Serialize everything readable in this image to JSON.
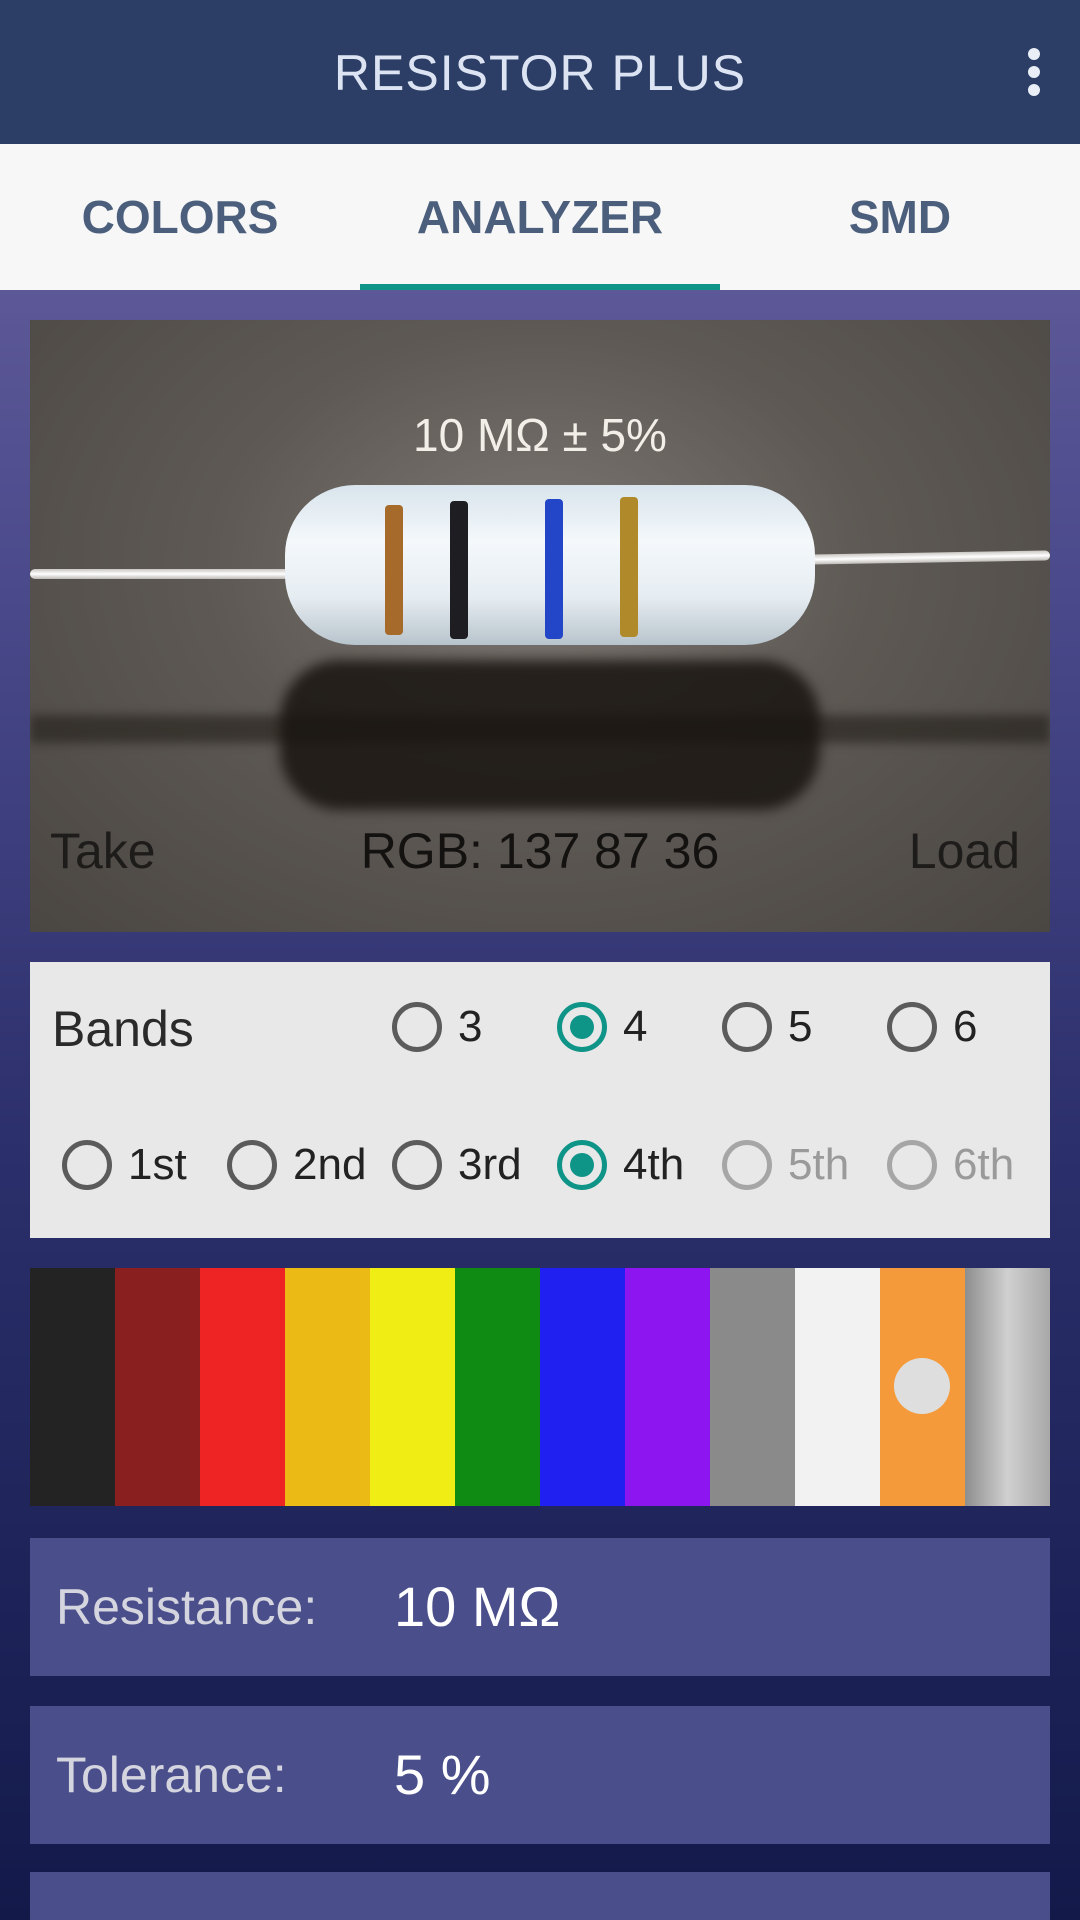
{
  "app": {
    "title": "RESISTOR  PLUS",
    "menu_icon": "more-vert-icon"
  },
  "tabs": [
    {
      "label": "COLORS",
      "active": false
    },
    {
      "label": "ANALYZER",
      "active": true
    },
    {
      "label": "SMD",
      "active": false
    }
  ],
  "accent_color": "#0f9488",
  "photo": {
    "value_label": "10 MΩ ± 5%",
    "take_label": "Take",
    "rgb_label": "RGB: 137 87 36",
    "load_label": "Load",
    "band_colors": [
      "#a66a2a",
      "#1e1e22",
      "#2346c8",
      "#b08a2a"
    ]
  },
  "bands": {
    "label": "Bands",
    "count_options": [
      {
        "label": "3",
        "checked": false
      },
      {
        "label": "4",
        "checked": true
      },
      {
        "label": "5",
        "checked": false
      },
      {
        "label": "6",
        "checked": false
      }
    ],
    "band_options": [
      {
        "label": "1st",
        "checked": false,
        "disabled": false
      },
      {
        "label": "2nd",
        "checked": false,
        "disabled": false
      },
      {
        "label": "3rd",
        "checked": false,
        "disabled": false
      },
      {
        "label": "4th",
        "checked": true,
        "disabled": false
      },
      {
        "label": "5th",
        "checked": false,
        "disabled": true
      },
      {
        "label": "6th",
        "checked": false,
        "disabled": true
      }
    ]
  },
  "palette": {
    "colors": [
      "#232323",
      "#8a1f1f",
      "#ee2424",
      "#ecba14",
      "#f0ed14",
      "#0f8a12",
      "#2020f0",
      "#8c15f0",
      "#8a8a8a",
      "#f2f2f2",
      "#f59a3a",
      "#b4b4b4"
    ],
    "selected_index": 10
  },
  "resistance": {
    "label": "Resistance:",
    "value": "10 MΩ"
  },
  "tolerance": {
    "label": "Tolerance:",
    "value": "5 %"
  }
}
